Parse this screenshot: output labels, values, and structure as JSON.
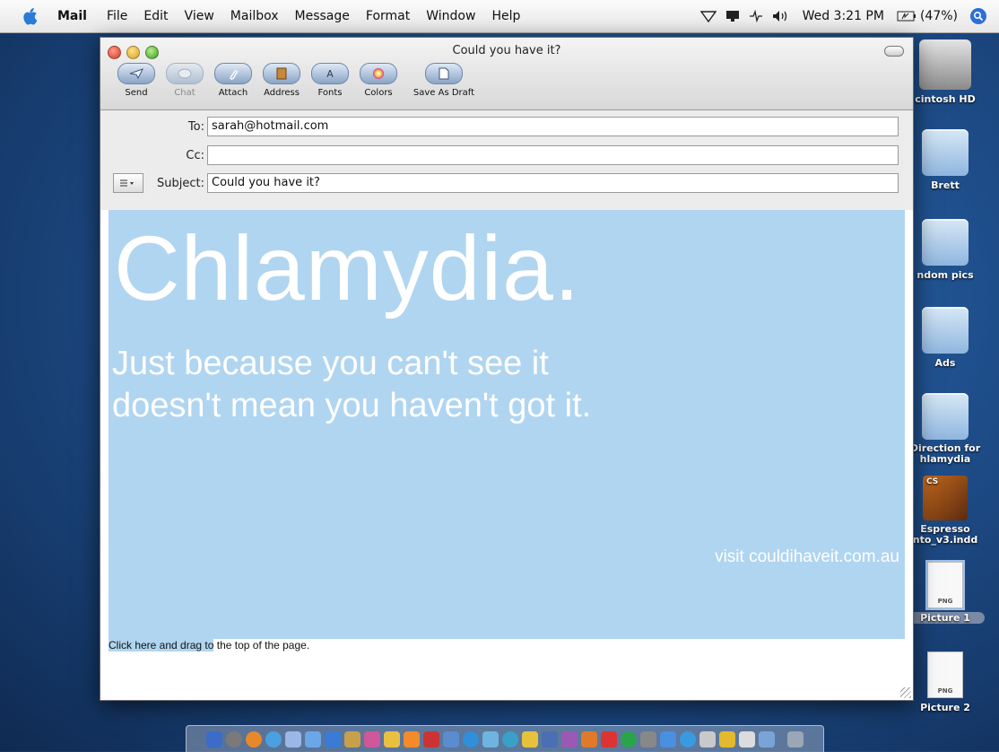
{
  "menubar": {
    "app": "Mail",
    "items": [
      "File",
      "Edit",
      "View",
      "Mailbox",
      "Message",
      "Format",
      "Window",
      "Help"
    ],
    "clock": "Wed 3:21 PM",
    "battery": "(47%)"
  },
  "desktop": {
    "icons": [
      {
        "label": "cintosh HD",
        "kind": "hd"
      },
      {
        "label": "Brett",
        "kind": "folder"
      },
      {
        "label": "ndom pics",
        "kind": "folder"
      },
      {
        "label": "Ads",
        "kind": "folder"
      },
      {
        "label": "Direction for\nhlamydia",
        "kind": "folder"
      },
      {
        "label": "Espresso\nnto_v3.indd",
        "kind": "indd"
      },
      {
        "label": "Picture 1",
        "kind": "png"
      },
      {
        "label": "Picture 2",
        "kind": "png"
      }
    ],
    "png_badge": "PNG",
    "indd_badge": "CS"
  },
  "window": {
    "title": "Could you have it?",
    "toolbar": {
      "send": "Send",
      "chat": "Chat",
      "attach": "Attach",
      "address": "Address",
      "fonts": "Fonts",
      "colors": "Colors",
      "save_draft": "Save As Draft"
    },
    "headers": {
      "to_label": "To:",
      "to_value": "sarah@hotmail.com",
      "cc_label": "Cc:",
      "cc_value": "",
      "subject_label": "Subject:",
      "subject_value": "Could you have it?"
    }
  },
  "message": {
    "headline": "Chlamydia.",
    "sub": "Just because you can't see it\ndoesn't mean you haven't got it.",
    "visit": "visit couldihaveit.com.au",
    "hint_selected": "Click here and drag to",
    "hint_rest": " the top of the page."
  },
  "colors": {
    "ad_background": "#b0d5f0",
    "ad_text": "#ffffff"
  }
}
